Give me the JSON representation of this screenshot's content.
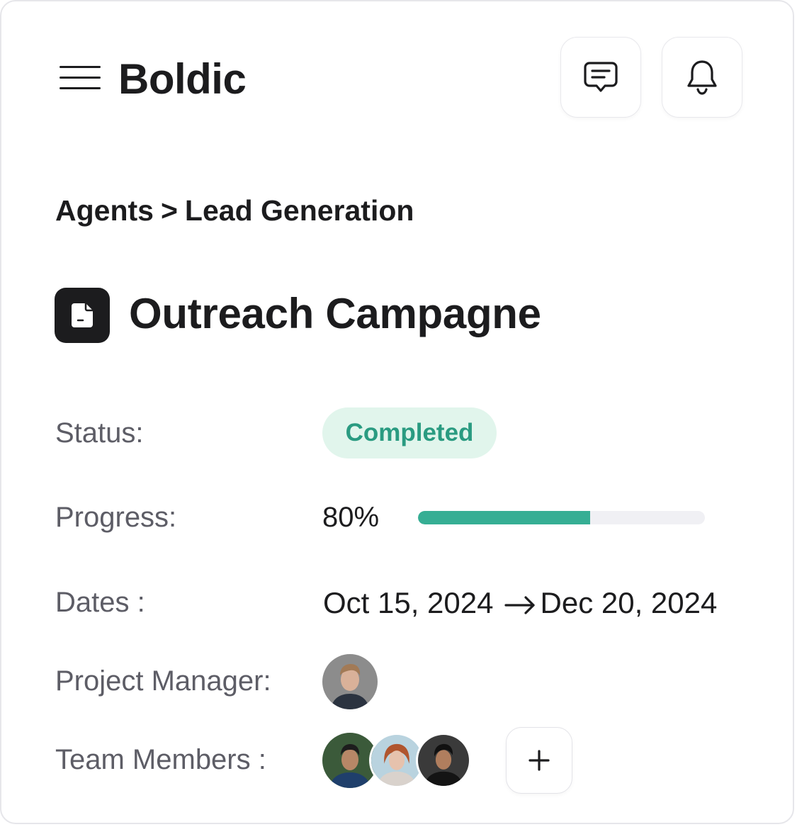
{
  "header": {
    "brand": "Boldic",
    "icons": {
      "menu": "hamburger-menu-icon",
      "messages": "chat-message-icon",
      "notifications": "bell-icon"
    }
  },
  "breadcrumb": {
    "items": [
      "Agents",
      "Lead Generation"
    ],
    "separator": ">"
  },
  "project": {
    "title": "Outreach Campagne",
    "icon": "document-icon"
  },
  "details": {
    "status_label": "Status:",
    "status_value": "Completed",
    "progress_label": "Progress:",
    "progress_value": "80%",
    "progress_fraction": 0.6,
    "dates_label": "Dates :",
    "start_date": "Oct 15, 2024",
    "end_date": "Dec 20, 2024",
    "manager_label": "Project Manager:",
    "team_label": "Team Members :",
    "team_count": 3,
    "add_member_icon": "plus-icon"
  },
  "colors": {
    "accent": "#36ae94",
    "status_bg": "#e1f5ec",
    "status_text": "#2a9b81",
    "text_primary": "#1c1c1e",
    "text_secondary": "#5d5d66",
    "track": "#f0f0f4"
  }
}
